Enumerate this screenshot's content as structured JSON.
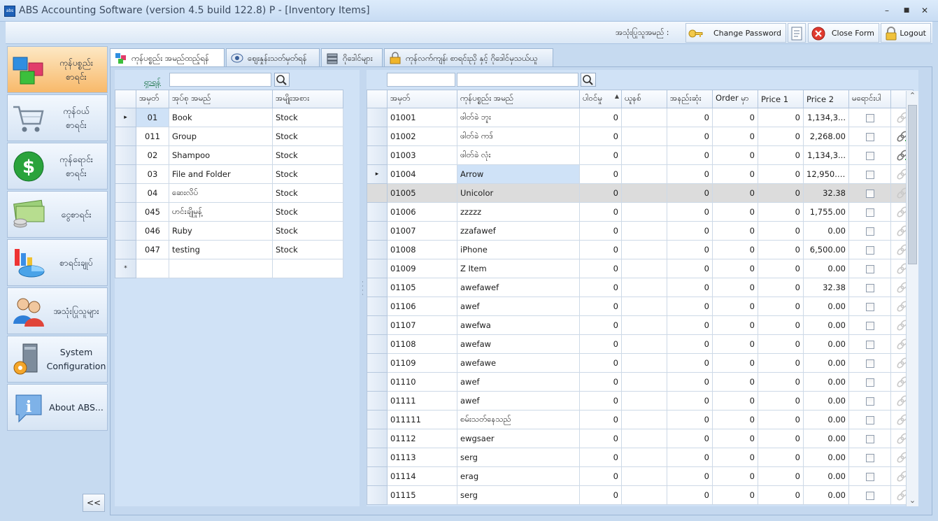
{
  "window": {
    "title": "ABS Accounting Software (version 4.5 build 122.8) P - [Inventory Items]",
    "app_icon_text": "abs",
    "minimize": "–",
    "maximize": "■",
    "close": "✕"
  },
  "topbar": {
    "user_label": "အသုံးပြုသူအမည် :",
    "change_password": "Change Password",
    "close_form": "Close Form",
    "logout": "Logout"
  },
  "nav": {
    "items": [
      {
        "label": "ကုန်ပစ္စည်း\nစာရင်း",
        "icon": "boxes-icon",
        "active": true
      },
      {
        "label": "ကုန်ဝယ်\nစာရင်း",
        "icon": "cart-icon"
      },
      {
        "label": "ကုန်ရောင်း\nစာရင်း",
        "icon": "dollar-icon"
      },
      {
        "label": "ငွေစာရင်း",
        "icon": "cash-icon"
      },
      {
        "label": "စာရင်းချုပ်",
        "icon": "chart-icon"
      },
      {
        "label": "အသုံးပြုသူများ",
        "icon": "users-icon"
      },
      {
        "label": "System\nConfiguration",
        "icon": "config-icon"
      },
      {
        "label": "About ABS...",
        "icon": "info-icon"
      }
    ],
    "collapse": "<<"
  },
  "tabs": [
    {
      "label": "ကုန်ပစ္စည်း အမည်ထည့်ရန်",
      "active": true
    },
    {
      "label": "ဈေးနှုန်းသတ်မှတ်ရန်"
    },
    {
      "label": "ဂိုဒေါင်များ"
    },
    {
      "label": "ကုန်လက်ကျန်၊ စာရင်းညှိ နှင့် ဂိုဒေါင်မှသယ်ယူ"
    }
  ],
  "groups": {
    "search_label": "ရှာရန်",
    "search_value": "",
    "columns": [
      "အမှတ်",
      "အုပ်စု အမည်",
      "အမျိုးအစား"
    ],
    "rows": [
      [
        "01",
        "Book",
        "Stock"
      ],
      [
        "011",
        "Group",
        "Stock"
      ],
      [
        "02",
        "Shampoo",
        "Stock"
      ],
      [
        "03",
        "File and Folder",
        "Stock"
      ],
      [
        "04",
        "ဆေးလိပ်",
        "Stock"
      ],
      [
        "045",
        "ဟင်းချိုမှုန့်",
        "Stock"
      ],
      [
        "046",
        "Ruby",
        "Stock"
      ],
      [
        "047",
        "testing",
        "Stock"
      ]
    ],
    "new_row_marker": "*",
    "current_marker": "▸"
  },
  "items": {
    "search_value_1": "",
    "search_value_2": "",
    "columns": [
      "အမှတ်",
      "ကုန်ပစ္စည်း အမည်",
      "ပါဝင်မှု",
      "ယူနစ်",
      "အနည်းဆုံး",
      "Order မှာ",
      "Price 1",
      "Price 2",
      "မရောင်းပါ"
    ],
    "sort_indicator": "▲",
    "rows": [
      {
        "code": "01001",
        "name": "ဖါတ်ခဲ ဘူး",
        "qty": "0",
        "unit": "",
        "min": "0",
        "order": "0",
        "p1": "0",
        "p2": "1,134,3...",
        "link": "grey"
      },
      {
        "code": "01002",
        "name": "ဖါတ်ခဲ ကဒ်",
        "qty": "0",
        "unit": "",
        "min": "0",
        "order": "0",
        "p1": "0",
        "p2": "2,268.00",
        "link": "add"
      },
      {
        "code": "01003",
        "name": "ဖါတ်ခဲ လုံး",
        "qty": "0",
        "unit": "",
        "min": "0",
        "order": "0",
        "p1": "0",
        "p2": "1,134,3...",
        "link": "add"
      },
      {
        "code": "01004",
        "name": "Arrow",
        "qty": "0",
        "unit": "",
        "min": "0",
        "order": "0",
        "p1": "0",
        "p2": "12,950.00",
        "link": "grey",
        "current": true
      },
      {
        "code": "01005",
        "name": "Unicolor",
        "qty": "0",
        "unit": "",
        "min": "0",
        "order": "0",
        "p1": "0",
        "p2": "32.38",
        "link": "grey",
        "selected": true
      },
      {
        "code": "01006",
        "name": "zzzzz",
        "qty": "0",
        "unit": "",
        "min": "0",
        "order": "0",
        "p1": "0",
        "p2": "1,755.00",
        "link": "grey"
      },
      {
        "code": "01007",
        "name": "zzafawef",
        "qty": "0",
        "unit": "",
        "min": "0",
        "order": "0",
        "p1": "0",
        "p2": "0.00",
        "link": "grey"
      },
      {
        "code": "01008",
        "name": "iPhone",
        "qty": "0",
        "unit": "",
        "min": "0",
        "order": "0",
        "p1": "0",
        "p2": "6,500.00",
        "link": "grey"
      },
      {
        "code": "01009",
        "name": "Z Item",
        "qty": "0",
        "unit": "",
        "min": "0",
        "order": "0",
        "p1": "0",
        "p2": "0.00",
        "link": "grey"
      },
      {
        "code": "01105",
        "name": "awefawef",
        "qty": "0",
        "unit": "",
        "min": "0",
        "order": "0",
        "p1": "0",
        "p2": "32.38",
        "link": "grey"
      },
      {
        "code": "01106",
        "name": "awef",
        "qty": "0",
        "unit": "",
        "min": "0",
        "order": "0",
        "p1": "0",
        "p2": "0.00",
        "link": "grey"
      },
      {
        "code": "01107",
        "name": "awefwa",
        "qty": "0",
        "unit": "",
        "min": "0",
        "order": "0",
        "p1": "0",
        "p2": "0.00",
        "link": "grey"
      },
      {
        "code": "01108",
        "name": "awefaw",
        "qty": "0",
        "unit": "",
        "min": "0",
        "order": "0",
        "p1": "0",
        "p2": "0.00",
        "link": "grey"
      },
      {
        "code": "01109",
        "name": "awefawe",
        "qty": "0",
        "unit": "",
        "min": "0",
        "order": "0",
        "p1": "0",
        "p2": "0.00",
        "link": "grey"
      },
      {
        "code": "01110",
        "name": "awef",
        "qty": "0",
        "unit": "",
        "min": "0",
        "order": "0",
        "p1": "0",
        "p2": "0.00",
        "link": "grey"
      },
      {
        "code": "01111",
        "name": "awef",
        "qty": "0",
        "unit": "",
        "min": "0",
        "order": "0",
        "p1": "0",
        "p2": "0.00",
        "link": "grey"
      },
      {
        "code": "011111",
        "name": "စမ်းသတ်နေသည်",
        "qty": "0",
        "unit": "",
        "min": "0",
        "order": "0",
        "p1": "0",
        "p2": "0.00",
        "link": "grey"
      },
      {
        "code": "01112",
        "name": "ewgsaer",
        "qty": "0",
        "unit": "",
        "min": "0",
        "order": "0",
        "p1": "0",
        "p2": "0.00",
        "link": "grey"
      },
      {
        "code": "01113",
        "name": "serg",
        "qty": "0",
        "unit": "",
        "min": "0",
        "order": "0",
        "p1": "0",
        "p2": "0.00",
        "link": "grey"
      },
      {
        "code": "01114",
        "name": "erag",
        "qty": "0",
        "unit": "",
        "min": "0",
        "order": "0",
        "p1": "0",
        "p2": "0.00",
        "link": "grey"
      },
      {
        "code": "01115",
        "name": "serg",
        "qty": "0",
        "unit": "",
        "min": "0",
        "order": "0",
        "p1": "0",
        "p2": "0.00",
        "link": "grey"
      }
    ],
    "scroll_up": "⌃",
    "scroll_down": "⌄"
  },
  "colors": {
    "title_text": "#3b4a5e",
    "nav_active": "#f8b96a",
    "link_green": "#0b6a3a",
    "selected_row": "#dcdcdc"
  }
}
